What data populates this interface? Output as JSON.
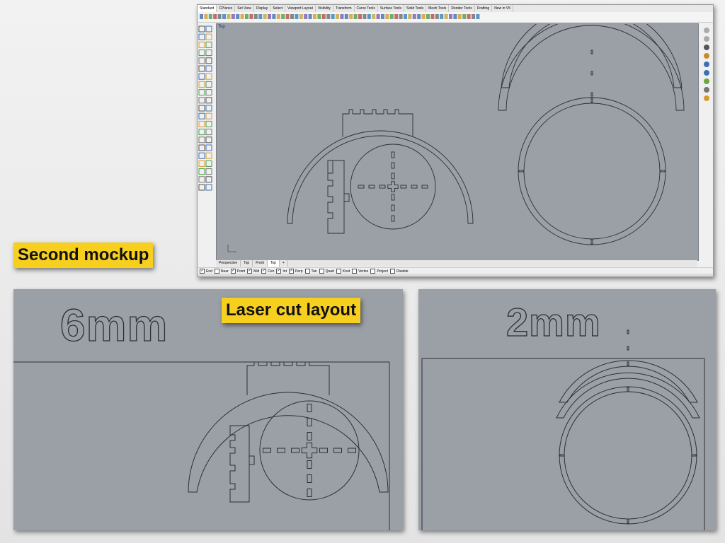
{
  "labels": {
    "second_mockup": "Second mockup",
    "laser_cut_layout": "Laser cut layout"
  },
  "panels": {
    "thickness_6": "6mm",
    "thickness_2": "2mm"
  },
  "rhino": {
    "toolbar_tabs": [
      "Standard",
      "CPlanes",
      "Set View",
      "Display",
      "Select",
      "Viewport Layout",
      "Visibility",
      "Transform",
      "Curve Tools",
      "Surface Tools",
      "Solid Tools",
      "Mesh Tools",
      "Render Tools",
      "Drafting",
      "New in V5"
    ],
    "viewport_label": "Top",
    "viewport_tabs": [
      "Perspective",
      "Top",
      "Front",
      "Top"
    ],
    "osnaps": [
      {
        "label": "End",
        "checked": true
      },
      {
        "label": "Near",
        "checked": false
      },
      {
        "label": "Point",
        "checked": true
      },
      {
        "label": "Mid",
        "checked": true
      },
      {
        "label": "Cen",
        "checked": true
      },
      {
        "label": "Int",
        "checked": true
      },
      {
        "label": "Perp",
        "checked": true
      },
      {
        "label": "Tan",
        "checked": false
      },
      {
        "label": "Quad",
        "checked": false
      },
      {
        "label": "Knot",
        "checked": false
      },
      {
        "label": "Vertex",
        "checked": false
      },
      {
        "label": "Project",
        "checked": false
      },
      {
        "label": "Disable",
        "checked": false
      }
    ]
  },
  "colors": {
    "label_bg": "#f7cf1e",
    "viewport_bg": "#9ba0a7",
    "curve_stroke": "#2c2f35"
  }
}
